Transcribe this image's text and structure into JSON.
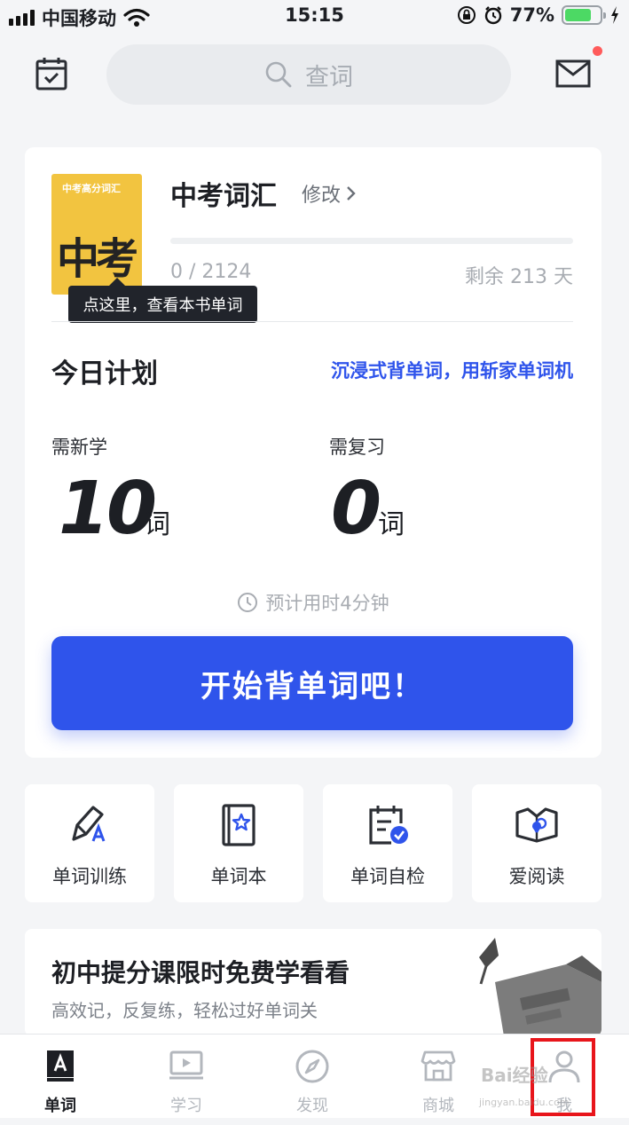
{
  "status_bar": {
    "carrier": "中国移动",
    "time": "15:15",
    "battery_percent": "77%",
    "battery_level": 0.77,
    "icons": [
      "signal-icon",
      "wifi-icon",
      "orientation-lock-icon",
      "alarm-icon",
      "battery-icon",
      "charging-icon"
    ]
  },
  "header": {
    "search_placeholder": "查词",
    "left_icon": "calendar-check-icon",
    "right_icon": "mail-icon",
    "has_notification_dot": true
  },
  "book": {
    "cover_title": "中考高分词汇",
    "cover_big": "中考",
    "title": "中考词汇",
    "edit_label": "修改",
    "progress_text": "0 / 2124",
    "progress_fraction": 0,
    "days_left": "剩余 213 天",
    "tooltip": "点这里，查看本书单词"
  },
  "plan": {
    "title": "今日计划",
    "link": "沉浸式背单词，用斩家单词机",
    "new_label": "需新学",
    "new_count": "10",
    "review_label": "需复习",
    "review_count": "0",
    "unit": "词",
    "eta": "预计用时4分钟",
    "start_button": "开始背单词吧！"
  },
  "tiles": [
    {
      "label": "单词训练",
      "icon": "pencil-icon"
    },
    {
      "label": "单词本",
      "icon": "wordbook-icon"
    },
    {
      "label": "单词自检",
      "icon": "calendar-check-icon"
    },
    {
      "label": "爱阅读",
      "icon": "open-book-icon"
    }
  ],
  "promo": {
    "title": "初中提分课限时免费学看看",
    "subtitle": "高效记，反复练，轻松过好单词关"
  },
  "tabs": [
    {
      "label": "单词",
      "icon": "word-tab-icon",
      "active": true
    },
    {
      "label": "学习",
      "icon": "video-icon",
      "active": false
    },
    {
      "label": "发现",
      "icon": "compass-icon",
      "active": false
    },
    {
      "label": "商城",
      "icon": "store-icon",
      "active": false
    },
    {
      "label": "我",
      "icon": "user-icon",
      "active": false
    }
  ],
  "colors": {
    "accent": "#2f54eb",
    "highlight_box": "#e8151b",
    "notification": "#ff5b5b",
    "book_cover": "#f2c440"
  }
}
